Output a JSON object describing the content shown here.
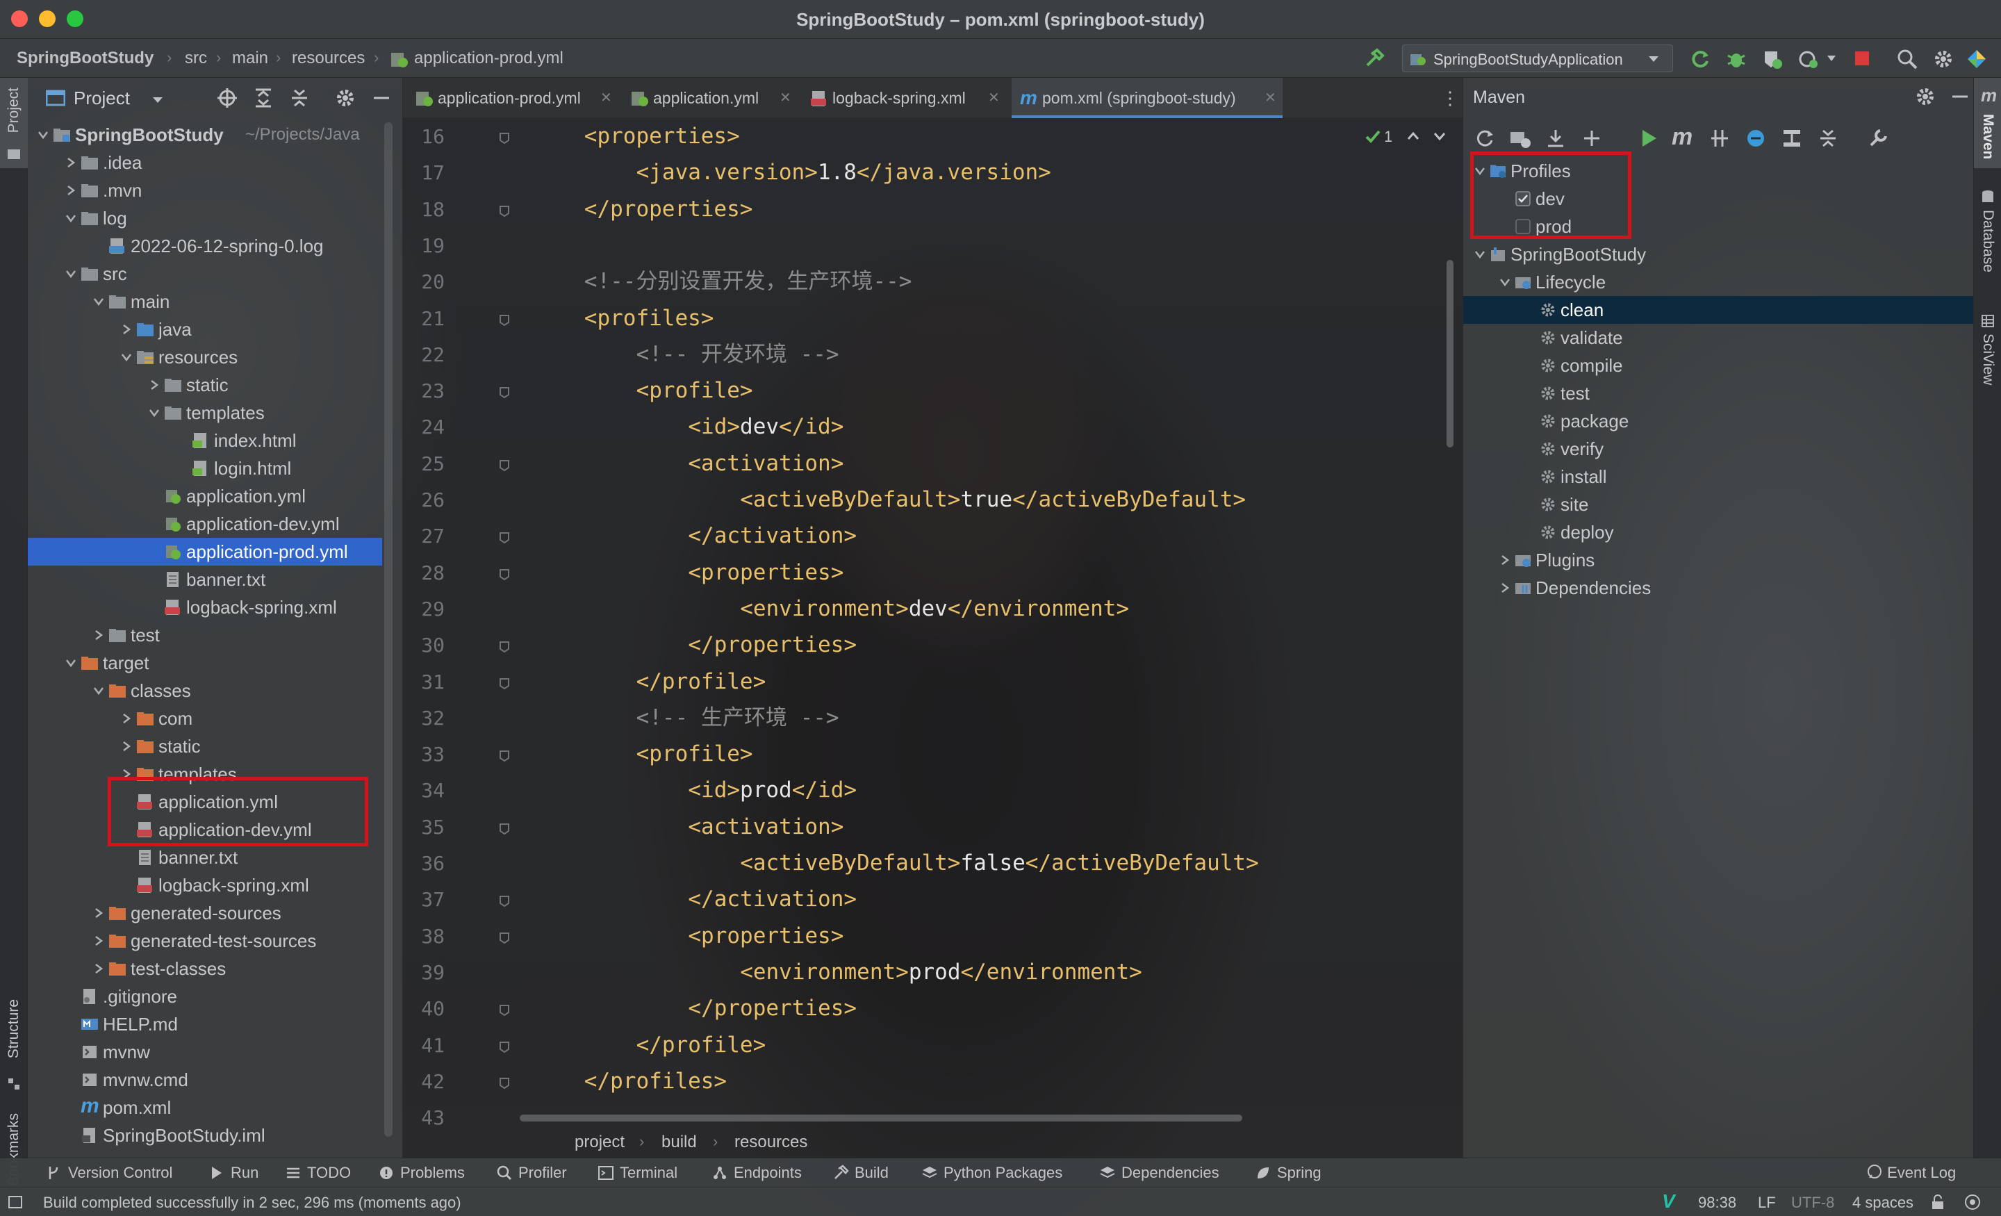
{
  "window": {
    "title": "SpringBootStudy – pom.xml (springboot-study)"
  },
  "nav": {
    "crumbs": [
      "SpringBootStudy",
      "src",
      "main",
      "resources",
      "application-prod.yml"
    ],
    "run_config": "SpringBootStudyApplication"
  },
  "left_stripe": {
    "project": "Project",
    "structure": "Structure",
    "bookmarks": "Bookmarks"
  },
  "project": {
    "title": "Project",
    "root_label": "SpringBootStudy",
    "root_path": "~/Projects/Java",
    "tree": [
      {
        "label": "SpringBootStudy",
        "depth": 0,
        "type": "module",
        "expanded": true
      },
      {
        "label": ".idea",
        "depth": 1,
        "type": "folder",
        "expanded": false
      },
      {
        "label": ".mvn",
        "depth": 1,
        "type": "folder",
        "expanded": false
      },
      {
        "label": "log",
        "depth": 1,
        "type": "folder",
        "expanded": true
      },
      {
        "label": "2022-06-12-spring-0.log",
        "depth": 2,
        "type": "log"
      },
      {
        "label": "src",
        "depth": 1,
        "type": "folder",
        "expanded": true
      },
      {
        "label": "main",
        "depth": 2,
        "type": "folder",
        "expanded": true
      },
      {
        "label": "java",
        "depth": 3,
        "type": "src-folder",
        "expanded": false
      },
      {
        "label": "resources",
        "depth": 3,
        "type": "res-folder",
        "expanded": true
      },
      {
        "label": "static",
        "depth": 4,
        "type": "folder",
        "expanded": false
      },
      {
        "label": "templates",
        "depth": 4,
        "type": "folder",
        "expanded": true
      },
      {
        "label": "index.html",
        "depth": 5,
        "type": "html"
      },
      {
        "label": "login.html",
        "depth": 5,
        "type": "html"
      },
      {
        "label": "application.yml",
        "depth": 4,
        "type": "yml-spring"
      },
      {
        "label": "application-dev.yml",
        "depth": 4,
        "type": "yml-spring"
      },
      {
        "label": "application-prod.yml",
        "depth": 4,
        "type": "yml-spring",
        "selected": true
      },
      {
        "label": "banner.txt",
        "depth": 4,
        "type": "txt"
      },
      {
        "label": "logback-spring.xml",
        "depth": 4,
        "type": "xml"
      },
      {
        "label": "test",
        "depth": 2,
        "type": "folder",
        "expanded": false
      },
      {
        "label": "target",
        "depth": 1,
        "type": "excluded-folder",
        "expanded": true
      },
      {
        "label": "classes",
        "depth": 2,
        "type": "excluded-folder",
        "expanded": true
      },
      {
        "label": "com",
        "depth": 3,
        "type": "excluded-folder",
        "expanded": false
      },
      {
        "label": "static",
        "depth": 3,
        "type": "excluded-folder",
        "expanded": false
      },
      {
        "label": "templates",
        "depth": 3,
        "type": "excluded-folder",
        "expanded": false
      },
      {
        "label": "application.yml",
        "depth": 3,
        "type": "yml"
      },
      {
        "label": "application-dev.yml",
        "depth": 3,
        "type": "yml"
      },
      {
        "label": "banner.txt",
        "depth": 3,
        "type": "txt"
      },
      {
        "label": "logback-spring.xml",
        "depth": 3,
        "type": "xml"
      },
      {
        "label": "generated-sources",
        "depth": 2,
        "type": "excluded-folder",
        "expanded": false
      },
      {
        "label": "generated-test-sources",
        "depth": 2,
        "type": "excluded-folder",
        "expanded": false
      },
      {
        "label": "test-classes",
        "depth": 2,
        "type": "excluded-folder",
        "expanded": false
      },
      {
        "label": ".gitignore",
        "depth": 1,
        "type": "gitignore"
      },
      {
        "label": "HELP.md",
        "depth": 1,
        "type": "md"
      },
      {
        "label": "mvnw",
        "depth": 1,
        "type": "script"
      },
      {
        "label": "mvnw.cmd",
        "depth": 1,
        "type": "script"
      },
      {
        "label": "pom.xml",
        "depth": 1,
        "type": "maven"
      },
      {
        "label": "SpringBootStudy.iml",
        "depth": 1,
        "type": "iml"
      }
    ]
  },
  "editor": {
    "tabs": [
      {
        "label": "application-prod.yml",
        "active": false
      },
      {
        "label": "application.yml",
        "active": false
      },
      {
        "label": "logback-spring.xml",
        "active": false
      },
      {
        "label": "pom.xml (springboot-study)",
        "active": true
      }
    ],
    "inspection_count": "1",
    "lines": [
      {
        "n": "16",
        "indent": 1,
        "parts": [
          [
            "tag",
            "<properties>"
          ]
        ]
      },
      {
        "n": "17",
        "indent": 2,
        "parts": [
          [
            "tag",
            "<java.version>"
          ],
          [
            "txt",
            "1.8"
          ],
          [
            "tag",
            "</java.version>"
          ]
        ]
      },
      {
        "n": "18",
        "indent": 1,
        "parts": [
          [
            "tag",
            "</properties>"
          ]
        ]
      },
      {
        "n": "19",
        "indent": 0,
        "parts": []
      },
      {
        "n": "20",
        "indent": 1,
        "parts": [
          [
            "cmt",
            "<!--分别设置开发，生产环境-->"
          ]
        ]
      },
      {
        "n": "21",
        "indent": 1,
        "parts": [
          [
            "tag",
            "<profiles>"
          ]
        ]
      },
      {
        "n": "22",
        "indent": 2,
        "parts": [
          [
            "cmt",
            "<!-- 开发环境 -->"
          ]
        ]
      },
      {
        "n": "23",
        "indent": 2,
        "parts": [
          [
            "tag",
            "<profile>"
          ]
        ]
      },
      {
        "n": "24",
        "indent": 3,
        "parts": [
          [
            "tag",
            "<id>"
          ],
          [
            "txt",
            "dev"
          ],
          [
            "tag",
            "</id>"
          ]
        ]
      },
      {
        "n": "25",
        "indent": 3,
        "parts": [
          [
            "tag",
            "<activation>"
          ]
        ]
      },
      {
        "n": "26",
        "indent": 4,
        "parts": [
          [
            "tag",
            "<activeByDefault>"
          ],
          [
            "txt",
            "true"
          ],
          [
            "tag",
            "</activeByDefault>"
          ]
        ]
      },
      {
        "n": "27",
        "indent": 3,
        "parts": [
          [
            "tag",
            "</activation>"
          ]
        ]
      },
      {
        "n": "28",
        "indent": 3,
        "parts": [
          [
            "tag",
            "<properties>"
          ]
        ]
      },
      {
        "n": "29",
        "indent": 4,
        "parts": [
          [
            "tag",
            "<environment>"
          ],
          [
            "txt",
            "dev"
          ],
          [
            "tag",
            "</environment>"
          ]
        ]
      },
      {
        "n": "30",
        "indent": 3,
        "parts": [
          [
            "tag",
            "</properties>"
          ]
        ]
      },
      {
        "n": "31",
        "indent": 2,
        "parts": [
          [
            "tag",
            "</profile>"
          ]
        ]
      },
      {
        "n": "32",
        "indent": 2,
        "parts": [
          [
            "cmt",
            "<!-- 生产环境 -->"
          ]
        ]
      },
      {
        "n": "33",
        "indent": 2,
        "parts": [
          [
            "tag",
            "<profile>"
          ]
        ]
      },
      {
        "n": "34",
        "indent": 3,
        "parts": [
          [
            "tag",
            "<id>"
          ],
          [
            "txt",
            "prod"
          ],
          [
            "tag",
            "</id>"
          ]
        ]
      },
      {
        "n": "35",
        "indent": 3,
        "parts": [
          [
            "tag",
            "<activation>"
          ]
        ]
      },
      {
        "n": "36",
        "indent": 4,
        "parts": [
          [
            "tag",
            "<activeByDefault>"
          ],
          [
            "txt",
            "false"
          ],
          [
            "tag",
            "</activeByDefault>"
          ]
        ]
      },
      {
        "n": "37",
        "indent": 3,
        "parts": [
          [
            "tag",
            "</activation>"
          ]
        ]
      },
      {
        "n": "38",
        "indent": 3,
        "parts": [
          [
            "tag",
            "<properties>"
          ]
        ]
      },
      {
        "n": "39",
        "indent": 4,
        "parts": [
          [
            "tag",
            "<environment>"
          ],
          [
            "txt",
            "prod"
          ],
          [
            "tag",
            "</environment>"
          ]
        ]
      },
      {
        "n": "40",
        "indent": 3,
        "parts": [
          [
            "tag",
            "</properties>"
          ]
        ]
      },
      {
        "n": "41",
        "indent": 2,
        "parts": [
          [
            "tag",
            "</profile>"
          ]
        ]
      },
      {
        "n": "42",
        "indent": 1,
        "parts": [
          [
            "tag",
            "</profiles>"
          ]
        ]
      },
      {
        "n": "43",
        "indent": 0,
        "parts": []
      }
    ],
    "breadcrumbs": [
      "project",
      "build",
      "resources"
    ]
  },
  "maven": {
    "title": "Maven",
    "tree": [
      {
        "label": "Profiles",
        "depth": 0,
        "type": "profiles",
        "expanded": true
      },
      {
        "label": "dev",
        "depth": 1,
        "type": "checkbox",
        "checked": true
      },
      {
        "label": "prod",
        "depth": 1,
        "type": "checkbox",
        "checked": false
      },
      {
        "label": "SpringBootStudy",
        "depth": 0,
        "type": "project",
        "expanded": true
      },
      {
        "label": "Lifecycle",
        "depth": 1,
        "type": "lifecycle",
        "expanded": true
      },
      {
        "label": "clean",
        "depth": 2,
        "type": "goal",
        "selected": true
      },
      {
        "label": "validate",
        "depth": 2,
        "type": "goal"
      },
      {
        "label": "compile",
        "depth": 2,
        "type": "goal"
      },
      {
        "label": "test",
        "depth": 2,
        "type": "goal"
      },
      {
        "label": "package",
        "depth": 2,
        "type": "goal"
      },
      {
        "label": "verify",
        "depth": 2,
        "type": "goal"
      },
      {
        "label": "install",
        "depth": 2,
        "type": "goal"
      },
      {
        "label": "site",
        "depth": 2,
        "type": "goal"
      },
      {
        "label": "deploy",
        "depth": 2,
        "type": "goal"
      },
      {
        "label": "Plugins",
        "depth": 1,
        "type": "plugins",
        "expanded": false
      },
      {
        "label": "Dependencies",
        "depth": 1,
        "type": "deps",
        "expanded": false
      }
    ]
  },
  "right_stripe": {
    "maven": "Maven",
    "database": "Database",
    "sciview": "SciView"
  },
  "bottom_tools": [
    {
      "label": "Version Control",
      "icon": "branch-icon"
    },
    {
      "label": "Run",
      "icon": "play-icon"
    },
    {
      "label": "TODO",
      "icon": "list-icon"
    },
    {
      "label": "Problems",
      "icon": "info-icon"
    },
    {
      "label": "Profiler",
      "icon": "profiler-icon"
    },
    {
      "label": "Terminal",
      "icon": "terminal-icon"
    },
    {
      "label": "Endpoints",
      "icon": "endpoints-icon"
    },
    {
      "label": "Build",
      "icon": "hammer-icon"
    },
    {
      "label": "Python Packages",
      "icon": "layers-icon"
    },
    {
      "label": "Dependencies",
      "icon": "layers-icon"
    },
    {
      "label": "Spring",
      "icon": "spring-icon"
    }
  ],
  "event_log": "Event Log",
  "status": {
    "message": "Build completed successfully in 2 sec, 296 ms (moments ago)",
    "position": "98:38",
    "line_sep": "LF",
    "encoding": "UTF-8",
    "indent": "4 spaces"
  },
  "colors": {
    "accent": "#2f65ca",
    "highlight_box": "#d3121c",
    "xml_tag": "#e8bf6a",
    "comment": "#8c8c8c"
  }
}
